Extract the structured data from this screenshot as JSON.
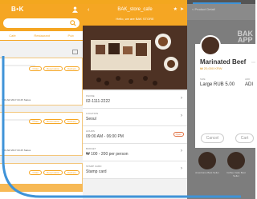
{
  "phone_left": {
    "logo": "B•K",
    "tabs": [
      "Cafe",
      "Restaurant",
      "Pub"
    ],
    "cards": [
      {
        "pills": [
          "Order",
          "Reservation",
          "Delivery"
        ],
        "meta": "7:00 AM  2017.03.25  Status"
      },
      {
        "pills": [
          "Order",
          "Reservation",
          "Delivery"
        ],
        "meta": "7:00 AM  2017.03.25  Status"
      },
      {
        "pills": [
          "Order",
          "Reservation",
          "Delivery"
        ],
        "meta": ""
      }
    ]
  },
  "phone_middle": {
    "title": "BAK_store_cafe",
    "hello": "Hello, we are BAK STORE",
    "rows": [
      {
        "label": "PHONE",
        "value": "02-1111-2222",
        "action": "chevron"
      },
      {
        "label": "LOCATION",
        "value": "Seoul",
        "action": "chevron"
      },
      {
        "label": "HOURS",
        "value": "09:00 AM - 06:00 PM",
        "action": "open"
      },
      {
        "label": "BUDGET",
        "value": "₩ 100 - 200 per person",
        "action": "chevron"
      },
      {
        "label": "STAMP CARD",
        "value": "Stamp card",
        "action": "chevron"
      }
    ],
    "open_label": "Open"
  },
  "phone_right": {
    "header": "< Product Detail",
    "bg_logo": "BAK\nAPP",
    "modal": {
      "title": "Marinated Beef",
      "price": "₩ 20,000 KRW",
      "size_label": "SIZE",
      "size_value": "Large RUB 5.00",
      "add_label": "ADD",
      "add_value": "ADI",
      "cancel": "Cancel",
      "cart": "Cart"
    },
    "products": [
      {
        "name": "Americano Best Seller"
      },
      {
        "name": "Coffee Cake Best Seller"
      }
    ]
  },
  "colors": {
    "brand": "#f5a623",
    "frame": "#3f93d8"
  }
}
